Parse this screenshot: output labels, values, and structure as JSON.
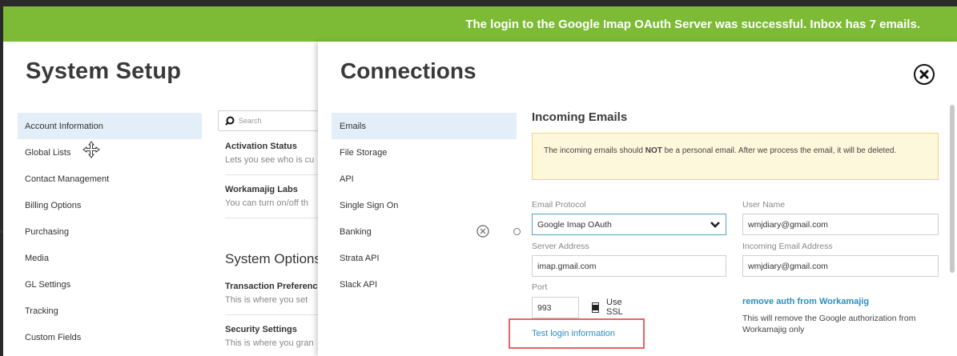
{
  "banner": {
    "message": "The login to the Google Imap OAuth Server was successful. Inbox has 7 emails."
  },
  "background": {
    "title": "System Setup",
    "sidebar_items": [
      "Account Information",
      "Global Lists",
      "Contact Management",
      "Billing Options",
      "Purchasing",
      "Media",
      "GL Settings",
      "Tracking",
      "Custom Fields"
    ],
    "search_placeholder": "Search",
    "rows": [
      {
        "title": "Activation Status",
        "desc": "Lets you see who is cu"
      },
      {
        "title": "Workamajig Labs",
        "desc": "You can turn on/off th"
      }
    ],
    "options_heading": "System Options",
    "options_rows": [
      {
        "title": "Transaction Preferences",
        "desc": "This is where you set"
      },
      {
        "title": "Security Settings",
        "desc": "This is where you gran"
      }
    ]
  },
  "modal": {
    "title": "Connections",
    "nav_items": [
      "Emails",
      "File Storage",
      "API",
      "Single Sign On",
      "Banking",
      "Strata API",
      "Slack API"
    ],
    "section_title": "Incoming Emails",
    "notice": {
      "before": "The incoming emails should ",
      "bold": "NOT",
      "after": " be a personal email. After we process the email, it will be deleted."
    },
    "fields": {
      "email_protocol": {
        "label": "Email Protocol",
        "value": "Google Imap OAuth"
      },
      "user_name": {
        "label": "User Name",
        "value": "wmjdiary@gmail.com"
      },
      "server_address": {
        "label": "Server Address",
        "value": "imap.gmail.com"
      },
      "incoming_email_address": {
        "label": "Incoming Email Address",
        "value": "wmjdiary@gmail.com"
      },
      "port": {
        "label": "Port",
        "value": "993"
      }
    },
    "use_ssl_label": "Use SSL",
    "test_login_label": "Test login information",
    "remove_auth_label": "remove auth from Workamajig",
    "remove_auth_desc": "This will remove the Google authorization from Workamajig only"
  }
}
